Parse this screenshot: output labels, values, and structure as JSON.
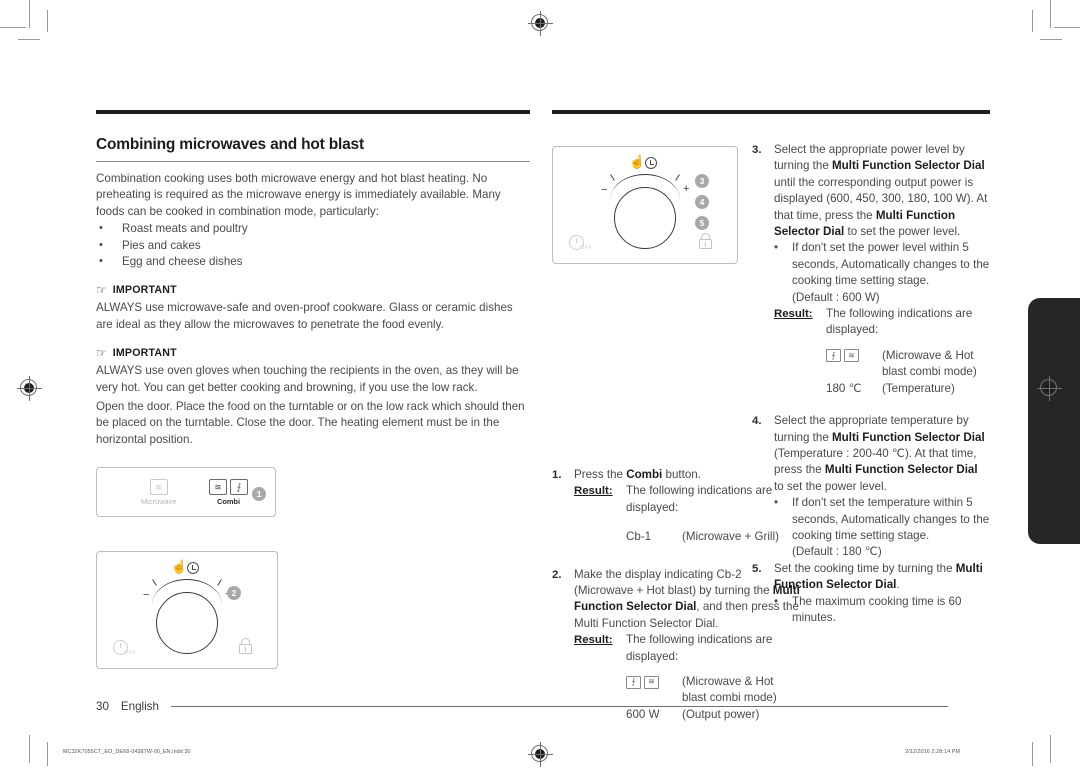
{
  "page": {
    "number": "30",
    "language": "English",
    "print_filename": "MC32K7055CT_EO_DE68-04387W-00_EN.indd   30",
    "print_timestamp": "2/12/2016   2:28:14 PM"
  },
  "left_column": {
    "title": "Combining microwaves and hot blast",
    "intro": "Combination cooking uses both microwave energy and hot blast heating. No preheating is required as the microwave energy is immediately available. Many foods can be cooked in combination mode, particularly:",
    "bullets": [
      "Roast meats and poultry",
      "Pies and cakes",
      "Egg and cheese dishes"
    ],
    "important_1": {
      "label": "IMPORTANT",
      "text": "ALWAYS use microwave-safe and oven-proof cookware. Glass or ceramic dishes are ideal as they allow the microwaves to penetrate the food evenly."
    },
    "important_2": {
      "label": "IMPORTANT",
      "text": "ALWAYS use oven gloves when touching the recipients in the oven, as they will be very hot. You can get better cooking and browning, if you use the low rack.",
      "text2": "Open the door. Place the food on the turntable or on the low rack which should then be placed on the turntable. Close the door. The heating element must be in the horizontal position."
    },
    "panel_keys": {
      "microwave_label": "Microwave",
      "combi_label": "Combi",
      "badge": "1",
      "microwave_icon": "microwave-wave-icon",
      "combi_icon_1": "microwave-wave-icon",
      "combi_icon_2": "hot-blast-icon"
    },
    "panel_dial": {
      "badge": "2",
      "minus": "−",
      "plus": "+",
      "hand_icon": "hand-press-icon",
      "clock_icon": "clock-icon",
      "off_label": "OFF",
      "lock_icon": "lock-icon"
    }
  },
  "mid_column": {
    "panel_dial": {
      "badges": [
        "3",
        "4",
        "5"
      ],
      "minus": "−",
      "plus": "+",
      "hand_icon": "hand-press-icon",
      "clock_icon": "clock-icon",
      "off_label": "OFF",
      "lock_icon": "lock-icon"
    },
    "steps": [
      {
        "num": "1.",
        "text_parts": [
          "Press the ",
          "Combi",
          " button."
        ],
        "result_label": "Result:",
        "result_text": "The following indications are displayed:",
        "display_value": "Cb-1",
        "display_note": "(Microwave + Grill)"
      },
      {
        "num": "2.",
        "text_parts": [
          "Make the display indicating Cb-2 (Microwave + Hot blast) by turning the ",
          "Multi Function Selector Dial",
          ", and then press the Multi Function Selector Dial."
        ],
        "result_label": "Result:",
        "result_text": "The following indications are displayed:",
        "icon_row_note_line1": "(Microwave & Hot",
        "icon_row_note_line2": "blast combi mode)",
        "display_value": "600 W",
        "display_note": "(Output power)"
      }
    ]
  },
  "right_column": {
    "steps": [
      {
        "num": "3.",
        "text_parts": [
          "Select the appropriate power level by turning the ",
          "Multi Function Selector Dial",
          " until the corresponding output power is displayed (600, 450, 300, 180, 100 W). At that time, press the ",
          "Multi Function Selector Dial",
          " to set the power level."
        ],
        "subbullet": "If don't set the power level within 5 seconds, Automatically changes to the cooking time setting stage.",
        "default_note": "(Default : 600 W)",
        "result_label": "Result:",
        "result_text": "The following indications are displayed:",
        "icon_row_note_line1": "(Microwave & Hot",
        "icon_row_note_line2": "blast combi mode)",
        "display_value": "180 ℃",
        "display_note": "(Temperature)"
      },
      {
        "num": "4.",
        "text_parts": [
          "Select the appropriate temperature by turning the ",
          "Multi Function Selector Dial",
          " (Temperature : 200-40 ℃). At that time, press the ",
          "Multi Function Selector Dial",
          " to set the power level."
        ],
        "subbullet": "If don't set the temperature within 5 seconds, Automatically changes to the cooking time setting stage.",
        "default_note": "(Default : 180 ℃)"
      },
      {
        "num": "5.",
        "text_parts": [
          "Set the cooking time by turning the ",
          "Multi Function Selector Dial",
          "."
        ],
        "subbullet": "The maximum cooking time is 60 minutes."
      }
    ]
  },
  "icons": {
    "wave": "≋",
    "hot_blast": "⨍",
    "hand": "☝",
    "pointer": "☞"
  }
}
